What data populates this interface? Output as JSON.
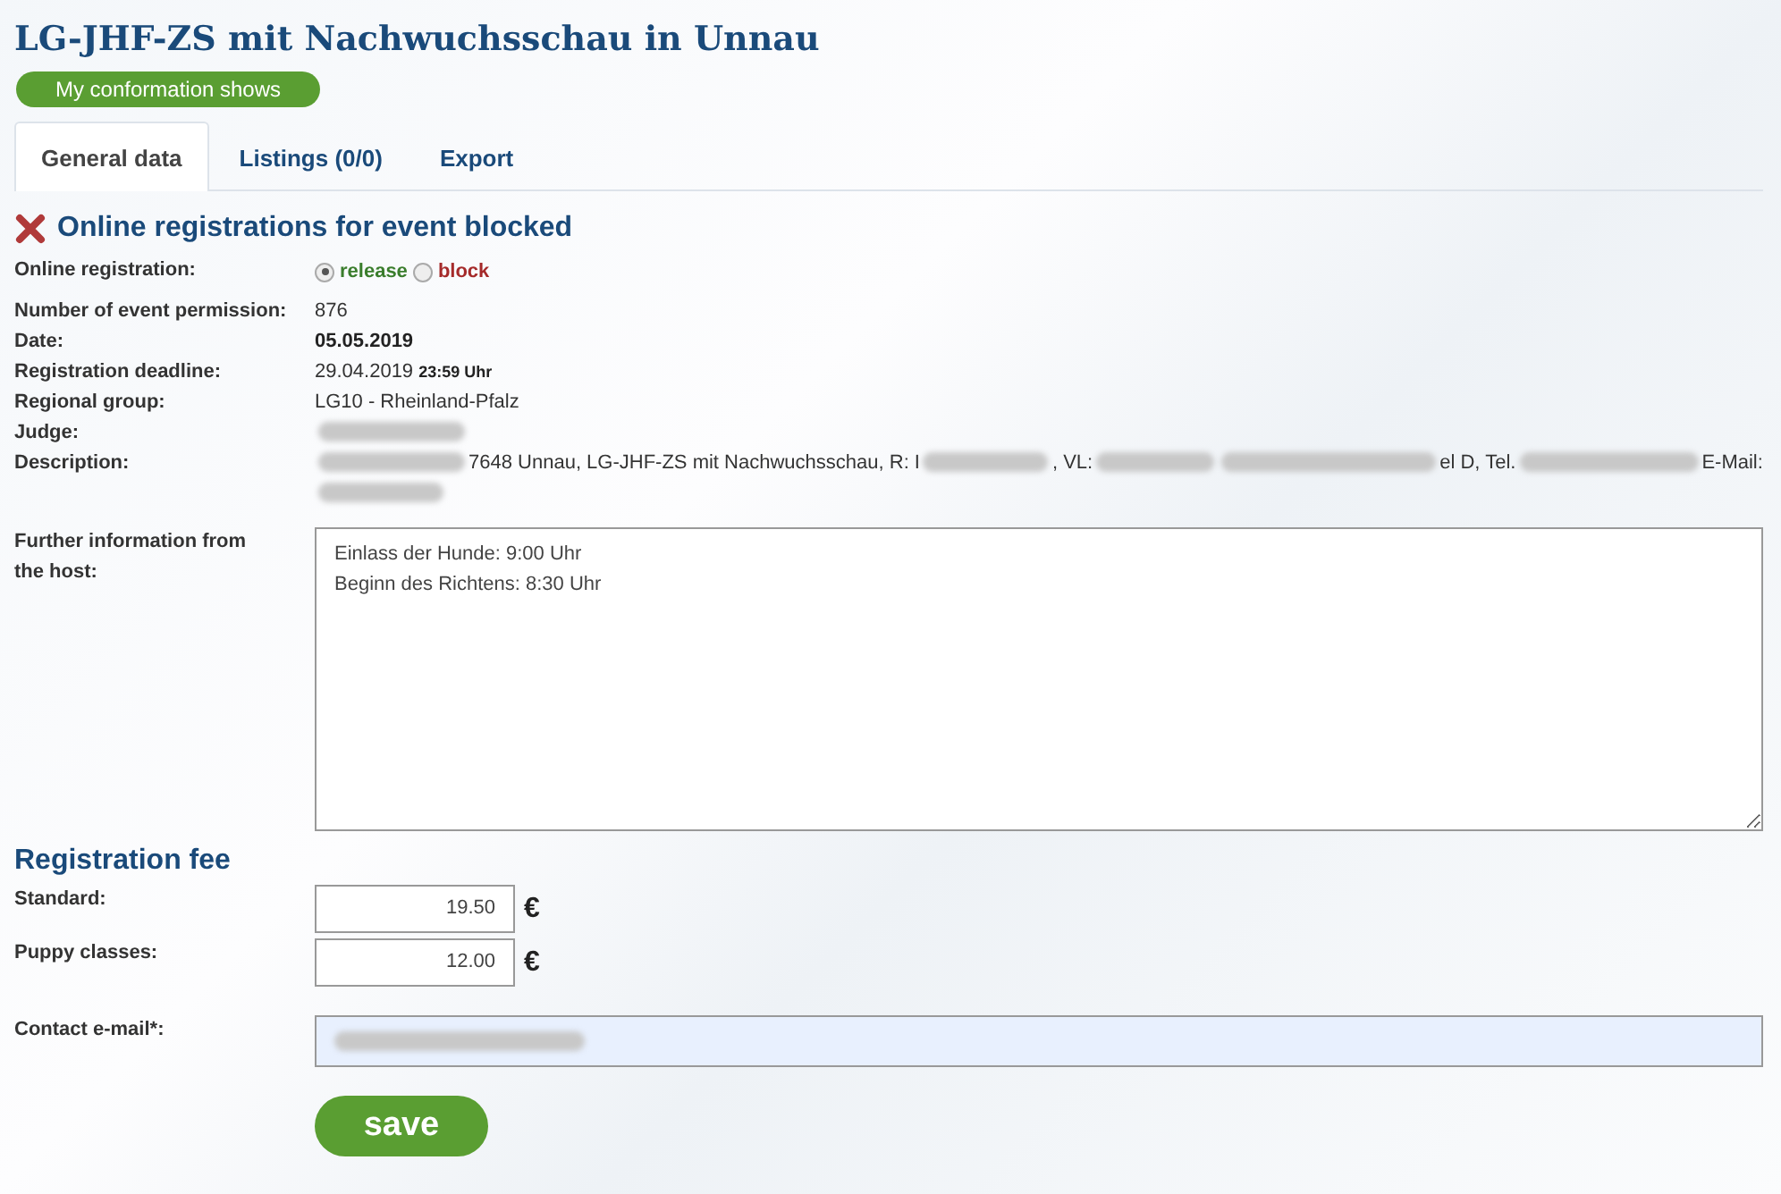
{
  "title": "LG-JHF-ZS mit Nachwuchsschau in Unnau",
  "shows_button": "My conformation shows",
  "tabs": [
    {
      "label": "General data",
      "selected": true
    },
    {
      "label": "Listings (0/0)",
      "selected": false
    },
    {
      "label": "Export",
      "selected": false
    }
  ],
  "status": {
    "blocked": true,
    "text": "Online registrations for event blocked"
  },
  "registration": {
    "label": "Online registration:",
    "options": [
      {
        "label": "release",
        "selected": true,
        "color": "#3a7d2c"
      },
      {
        "label": "block",
        "selected": false,
        "color": "#a52a2a"
      }
    ]
  },
  "fields": [
    {
      "label": "Number of event permission:",
      "parts": [
        {
          "kind": "text",
          "text": "876"
        }
      ]
    },
    {
      "label": "Date:",
      "parts": [
        {
          "kind": "bold",
          "text": "05.05.2019"
        }
      ]
    },
    {
      "label": "Registration deadline:",
      "parts": [
        {
          "kind": "text",
          "text": "29.04.2019"
        },
        {
          "kind": "small-bold",
          "text": "23:59 Uhr"
        }
      ]
    },
    {
      "label": "Regional group:",
      "parts": [
        {
          "kind": "text",
          "text": "LG10 - Rheinland-Pfalz"
        }
      ]
    },
    {
      "label": "Judge:",
      "parts": [
        {
          "kind": "redacted"
        }
      ]
    },
    {
      "label": "Description:",
      "parts": [
        {
          "kind": "redacted"
        },
        {
          "kind": "text",
          "text": "7648 Unnau, LG-JHF-ZS mit Nachwuchsschau, R: I"
        },
        {
          "kind": "redacted"
        },
        {
          "kind": "text",
          "text": ", VL:"
        },
        {
          "kind": "redacted"
        },
        {
          "kind": "redacted"
        },
        {
          "kind": "text",
          "text": "el D, Tel."
        },
        {
          "kind": "redacted"
        },
        {
          "kind": "text",
          "text": "E-Mail:"
        },
        {
          "kind": "redacted"
        }
      ]
    }
  ],
  "further_info": {
    "label": "Further information from the host:",
    "value": "Einlass der Hunde: 9:00 Uhr\nBeginn des Richtens: 8:30 Uhr"
  },
  "fee": {
    "heading": "Registration fee",
    "rows": [
      {
        "label": "Standard:",
        "value": "19.50",
        "currency": "€"
      },
      {
        "label": "Puppy classes:",
        "value": "12.00",
        "currency": "€"
      }
    ]
  },
  "contact": {
    "label": "Contact e-mail*:",
    "redacted": true
  },
  "save_button": "save"
}
